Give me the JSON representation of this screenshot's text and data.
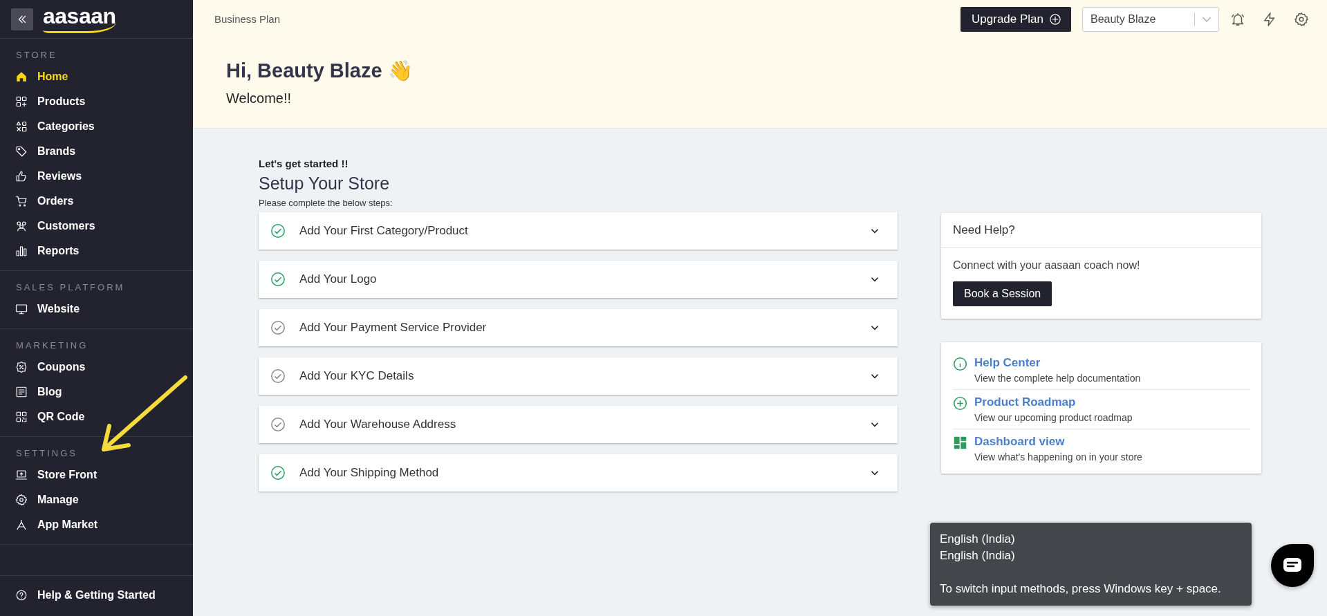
{
  "sidebar": {
    "logo": "aasaan",
    "sections": [
      {
        "title": "STORE",
        "items": [
          {
            "label": "Home",
            "selected": true
          },
          {
            "label": "Products",
            "selected": false
          },
          {
            "label": "Categories",
            "selected": false
          },
          {
            "label": "Brands",
            "selected": false
          },
          {
            "label": "Reviews",
            "selected": false
          },
          {
            "label": "Orders",
            "selected": false
          },
          {
            "label": "Customers",
            "selected": false
          },
          {
            "label": "Reports",
            "selected": false
          }
        ]
      },
      {
        "title": "SALES PLATFORM",
        "items": [
          {
            "label": "Website",
            "selected": false
          }
        ]
      },
      {
        "title": "MARKETING",
        "items": [
          {
            "label": "Coupons",
            "selected": false
          },
          {
            "label": "Blog",
            "selected": false
          },
          {
            "label": "QR Code",
            "selected": false
          }
        ]
      },
      {
        "title": "SETTINGS",
        "items": [
          {
            "label": "Store Front",
            "selected": false
          },
          {
            "label": "Manage",
            "selected": false
          },
          {
            "label": "App Market",
            "selected": false
          }
        ]
      }
    ],
    "footer": "Help & Getting Started"
  },
  "topbar": {
    "plan": "Business Plan",
    "upgrade_button": "Upgrade Plan",
    "store_select": "Beauty Blaze"
  },
  "greeting": {
    "title": "Hi, Beauty Blaze 👋",
    "subtitle": "Welcome!!"
  },
  "setup": {
    "kicker": "Let's get started !!",
    "title": "Setup Your Store",
    "hint": "Please complete the below steps:",
    "steps": [
      {
        "label": "Add Your First Category/Product",
        "completed": true
      },
      {
        "label": "Add Your Logo",
        "completed": true
      },
      {
        "label": "Add Your Payment Service Provider",
        "completed": false
      },
      {
        "label": "Add Your KYC Details",
        "completed": false
      },
      {
        "label": "Add Your Warehouse Address",
        "completed": false
      },
      {
        "label": "Add Your Shipping Method",
        "completed": true
      }
    ]
  },
  "help": {
    "title": "Need Help?",
    "text": "Connect with your aasaan coach now!",
    "button": "Book a Session",
    "links": [
      {
        "title": "Help Center",
        "description": "View the complete help documentation"
      },
      {
        "title": "Product Roadmap",
        "description": "View our upcoming product roadmap"
      },
      {
        "title": "Dashboard view",
        "description": "View what's happening on in your store"
      }
    ]
  },
  "tooltip": {
    "lines": [
      "English (India)",
      "English (India)"
    ],
    "hint": "To switch input methods, press Windows key + space."
  }
}
